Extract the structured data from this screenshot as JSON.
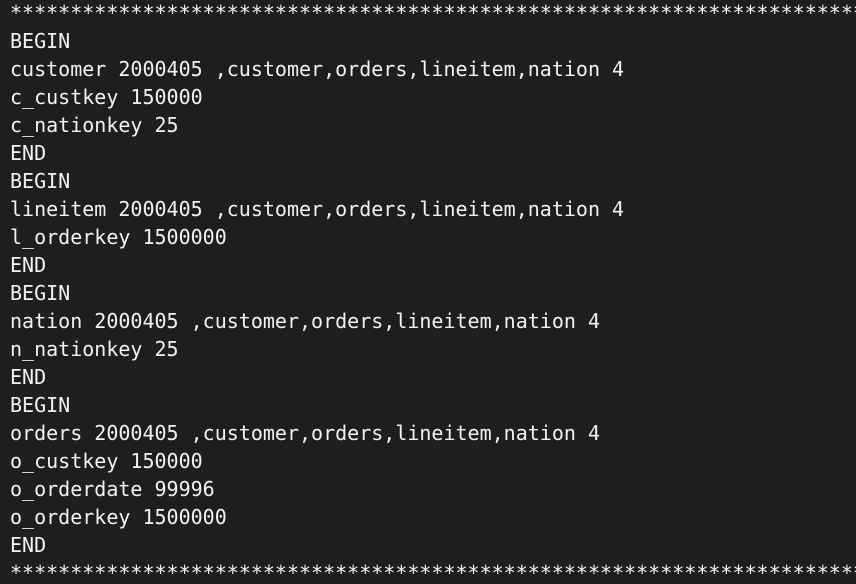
{
  "terminal": {
    "lines": [
      "**************************************************************************************",
      "BEGIN",
      "customer 2000405 ,customer,orders,lineitem,nation 4",
      "c_custkey 150000",
      "c_nationkey 25",
      "END",
      "BEGIN",
      "lineitem 2000405 ,customer,orders,lineitem,nation 4",
      "l_orderkey 1500000",
      "END",
      "BEGIN",
      "nation 2000405 ,customer,orders,lineitem,nation 4",
      "n_nationkey 25",
      "END",
      "BEGIN",
      "orders 2000405 ,customer,orders,lineitem,nation 4",
      "o_custkey 150000",
      "o_orderdate 99996",
      "o_orderkey 1500000",
      "END",
      "**************************************************************************************"
    ],
    "background_color": "#1e1e1e",
    "text_color": "#f2f2f2"
  }
}
